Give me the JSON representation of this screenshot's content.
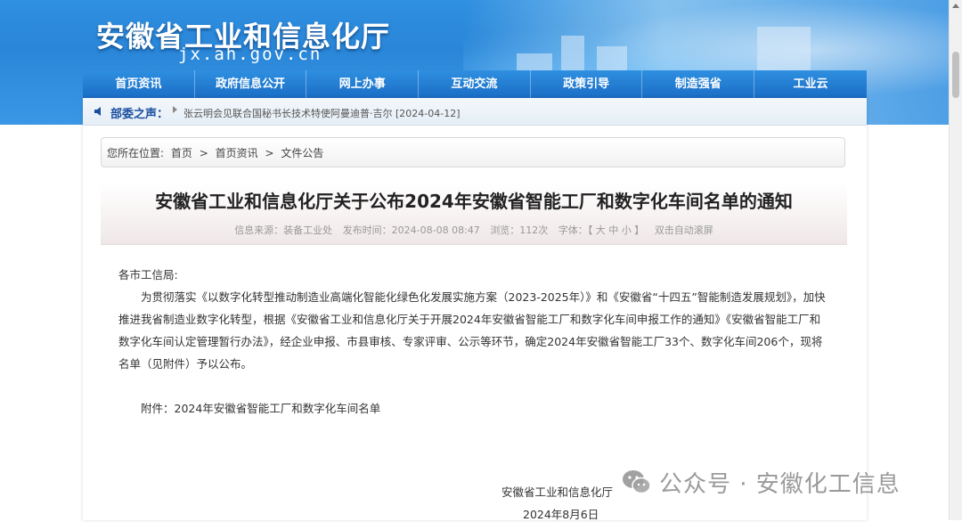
{
  "header": {
    "site_title": "安徽省工业和信息化厅",
    "domain": "jx.ah.gov.cn"
  },
  "nav": {
    "items": [
      "首页资讯",
      "政府信息公开",
      "网上办事",
      "互动交流",
      "政策引导",
      "制造强省",
      "工业云"
    ]
  },
  "news_bar": {
    "label": "部委之声：",
    "text": "张云明会见联合国秘书长技术特使阿曼迪普·吉尔 [2024-04-12]"
  },
  "breadcrumb": {
    "prefix": "您所在位置:",
    "home": "首页",
    "sep1": ">",
    "section": "首页资讯",
    "sep2": ">",
    "current": "文件公告"
  },
  "article": {
    "title": "安徽省工业和信息化厅关于公布2024年安徽省智能工厂和数字化车间名单的通知",
    "meta": {
      "source": "信息来源：装备工业处",
      "publish_time": "发布时间：2024-08-08 08:47",
      "views": "浏览：112次",
      "font_label": "字体：",
      "font_sizes": "【 大 中 小 】",
      "auto_scroll": "双击自动滚屏"
    },
    "greeting": "各市工信局:",
    "paragraph": "为贯彻落实《以数字化转型推动制造业高端化智能化绿色化发展实施方案（2023-2025年）》和《安徽省“十四五”智能制造发展规划》，加快推进我省制造业数字化转型，根据《安徽省工业和信息化厅关于开展2024年安徽省智能工厂和数字化车间申报工作的通知》《安徽省智能工厂和数字化车间认定管理暂行办法》，经企业申报、市县审核、专家评审、公示等环节，确定2024年安徽省智能工厂33个、数字化车间206个，现将名单（见附件）予以公布。",
    "attachment": "附件：2024年安徽省智能工厂和数字化车间名单",
    "sign_org": "安徽省工业和信息化厅",
    "sign_date": "2024年8月6日"
  },
  "watermark": {
    "text": "公众号 · 安徽化工信息"
  },
  "colors": {
    "header_blue": "#2a86d8",
    "nav_blue": "#1a6dc5",
    "news_label": "#1a4fa0"
  }
}
